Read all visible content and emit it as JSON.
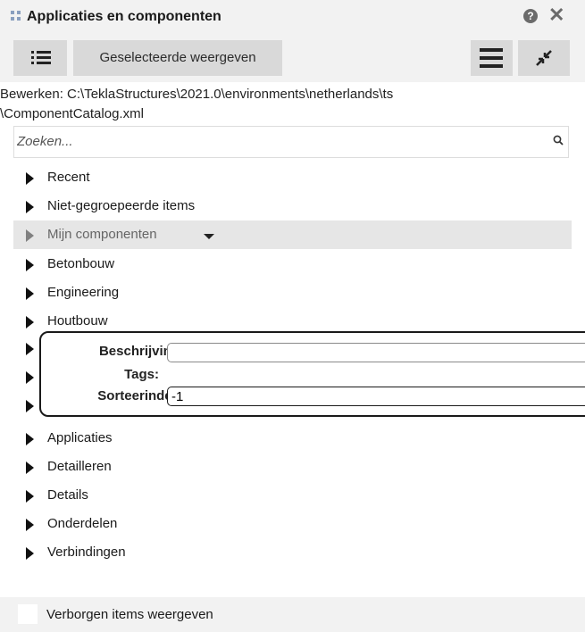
{
  "window": {
    "title": "Applicaties en componenten",
    "help_icon": "?",
    "close_icon": "✕"
  },
  "toolbar": {
    "list_view_icon": "list-icon",
    "show_selected_label": "Geselecteerde weergeven",
    "menu_icon": "hamburger-icon",
    "collapse_icon": "collapse-icon"
  },
  "path": {
    "line1": "Bewerken:  C:\\TeklaStructures\\2021.0\\environments\\netherlands\\ts",
    "line2": "\\ComponentCatalog.xml"
  },
  "search": {
    "placeholder": "Zoeken..."
  },
  "tree": {
    "items_top": [
      {
        "label": "Recent"
      },
      {
        "label": "Niet-gegroepeerde items"
      },
      {
        "label": "Mijn componenten"
      },
      {
        "label": "Betonbouw"
      },
      {
        "label": "Engineering"
      },
      {
        "label": "Houtbouw"
      }
    ],
    "items_bottom": [
      {
        "label": "Applicaties"
      },
      {
        "label": "Detailleren"
      },
      {
        "label": "Details"
      },
      {
        "label": "Onderdelen"
      },
      {
        "label": "Verbindingen"
      }
    ]
  },
  "properties_popup": {
    "description_label": "Beschrijving:",
    "description_value": "",
    "tags_label": "Tags:",
    "sortindex_label": "Sorteerindex:",
    "sortindex_value": "-1"
  },
  "footer": {
    "show_hidden_label": "Verborgen items weergeven",
    "show_hidden_checked": false
  },
  "colors": {
    "panel_bg": "#f2f2f2",
    "button_bg": "#d9d9d9",
    "highlight_row": "#e6e6e6"
  }
}
